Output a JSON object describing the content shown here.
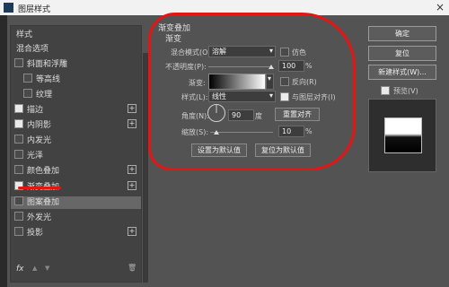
{
  "window": {
    "title": "图层样式",
    "close": "×"
  },
  "sidebar": {
    "heading": "样式",
    "items": [
      {
        "label": "混合选项",
        "checkbox": false
      },
      {
        "label": "斜面和浮雕",
        "checkbox": true,
        "checked": false
      },
      {
        "label": "等高线",
        "checkbox": true,
        "checked": false
      },
      {
        "label": "纹理",
        "checkbox": true,
        "checked": false
      },
      {
        "label": "描边",
        "checkbox": true,
        "checked": true,
        "plus": true
      },
      {
        "label": "内阴影",
        "checkbox": true,
        "checked": true,
        "plus": true
      },
      {
        "label": "内发光",
        "checkbox": true,
        "checked": false
      },
      {
        "label": "光泽",
        "checkbox": true,
        "checked": false
      },
      {
        "label": "颜色叠加",
        "checkbox": true,
        "checked": false,
        "plus": true
      },
      {
        "label": "渐变叠加",
        "checkbox": true,
        "checked": true,
        "plus": true,
        "selected": true
      },
      {
        "label": "图案叠加",
        "checkbox": true,
        "checked": false
      },
      {
        "label": "外发光",
        "checkbox": true,
        "checked": false
      },
      {
        "label": "投影",
        "checkbox": true,
        "checked": false,
        "plus": true
      }
    ],
    "footer": {
      "fx": "fx",
      "up": "▲",
      "down": "▼",
      "trash": "🗑"
    }
  },
  "main": {
    "section_title": "渐变叠加",
    "sub_title": "渐变",
    "blend_mode_label": "混合模式(O):",
    "blend_mode_value": "溶解",
    "dither_label": "仿色",
    "opacity_label": "不透明度(P):",
    "opacity_value": "100",
    "opacity_unit": "%",
    "gradient_label": "渐变:",
    "reverse_label": "反向(R)",
    "style_label": "样式(L):",
    "style_value": "线性",
    "align_label": "与图层对齐(I)",
    "angle_label": "角度(N):",
    "angle_value": "90",
    "angle_unit": "度",
    "reset_align": "重置对齐",
    "scale_label": "缩放(S):",
    "scale_value": "10",
    "scale_unit": "%",
    "set_default": "设置为默认值",
    "reset_default": "复位为默认值",
    "opacity_fraction": 1.0,
    "scale_fraction": 0.1
  },
  "right": {
    "ok": "确定",
    "reset": "复位",
    "new_style": "新建样式(W)...",
    "preview_label": "预览(V)",
    "preview_checked": true
  },
  "annotation_color": "#e31515"
}
